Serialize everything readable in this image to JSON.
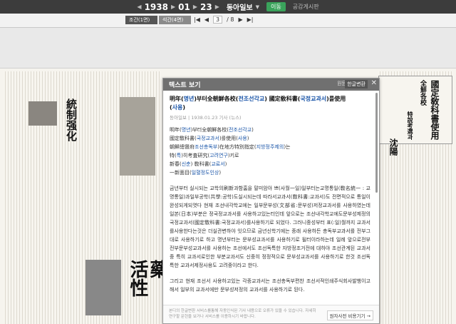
{
  "header": {
    "year": "1938",
    "month": "01",
    "day": "23",
    "newspaper": "동아일보",
    "go_label": "이동",
    "link": "공감게시판",
    "icons": [
      "prev-arrow-icon",
      "next-arrow-icon",
      "dropdown-icon"
    ]
  },
  "toolbar": {
    "edition_tabs": [
      "조간(1면)",
      "석간(4면)"
    ],
    "current_page": "3",
    "total_pages": "/ 8",
    "icons": [
      "first-page-icon",
      "prev-page-icon",
      "next-page-icon",
      "last-page-icon"
    ]
  },
  "newspaper_view": {
    "headlines": [
      "國定敎科書使用",
      "全鮮各校",
      "特說考選과",
      "沈陽",
      "活性",
      "藥"
    ]
  },
  "popup": {
    "title": "텍스트 보기",
    "btn_original": "원문",
    "btn_korean": "한글변환",
    "close": "✕",
    "article_title_pre": "明年(",
    "article_title_blue1": "명년",
    "article_title_mid1": ")부터全朝鮮各校(",
    "article_title_blue2": "전조선각교",
    "article_title_mid2": ") 國定敎科書(",
    "article_title_blue3": "국정교과서",
    "article_title_mid3": ")를使用",
    "article_title_line2_pre": "(",
    "article_title_line2_blue": "사용",
    "article_title_line2_post": ")",
    "meta": "동아일보 | 1938.01.23 기사 (뉴스)",
    "vlines": [
      [
        "明年(",
        "명년",
        ")부터全朝鮮各校(",
        "전조선각교",
        ")"
      ],
      [
        "國定敎科書(",
        "국정교과서",
        ")를使用(",
        "사용",
        ")"
      ],
      [
        "朝鮮總督府",
        "조선총독부",
        ")在地方特別指定(",
        "지방정주제의",
        ")는"
      ],
      [
        "特(",
        "특",
        ")히考査研究(",
        "고려연구",
        ")키로"
      ],
      [
        "新春(",
        "신춘",
        ") 敎科書(",
        "교료서",
        ")"
      ],
      [
        "一新面目(",
        "일혈정도인상",
        ")"
      ]
    ],
    "para1": "금년부터 실시되는 교학의刷新과함홈을 말미암아 쁘(사월一일)일부터는교명통일(敎名統一 : 교명통일)과일부공학(共學:공학)도실시되는데 따라서교과서(敎科書:교과서)도 전면적으로 통일이완성되게되엿다 현재 조선내각학교에는 일부문부성(文部省:문부성)저정교과서를 사용하였는데 일본(日本)부분은 정국정교과서를 사용하고있는터인데 앞으로는 조선내각학교에도문부성제정의 국정교과서(國定敎科書:국정교과서)를사용하기로 되었다. 그러니중성부터 표(:일)월까지 교과서를사용한다는것은 더실관변하야 잇으므로 금년신학기에는 종래 사용하든 총독부교과서를 전부그대로 사용하기로 하고 명년부터는 문부성교과서를 사용하기로 될터이라하는데 일례 앞으로전부 전부문부성교과서를 사용하는 조선에서도 조선독특한 자방정조거전에 대하야 조선관계된 교과서 중 특히 교과서로인한 부분교과서도 신중히 정정적으로 문부성교과서를 사용하기로 한것 조선독특한 교과서제정사용도 고려중이라고 한다.",
    "para2": "그리고 현재 조선서 사용하고있는 각종교과서는 조선총독부편찬 조선서적인쇄주식회사발행이고 해서 일부의 교과서에만 문부성저정의 교과서를 사용하기로 된다.",
    "foot_note": "본디의 한글변환 서비스를통해 자동인식된 기사 내용으로 오류가 있을 수 있습니다. 자세히 연구할 문헌을 보거나 서비스를 이용하시기 바랍니다.",
    "foot_button": "원자사전 비용기기 →"
  }
}
